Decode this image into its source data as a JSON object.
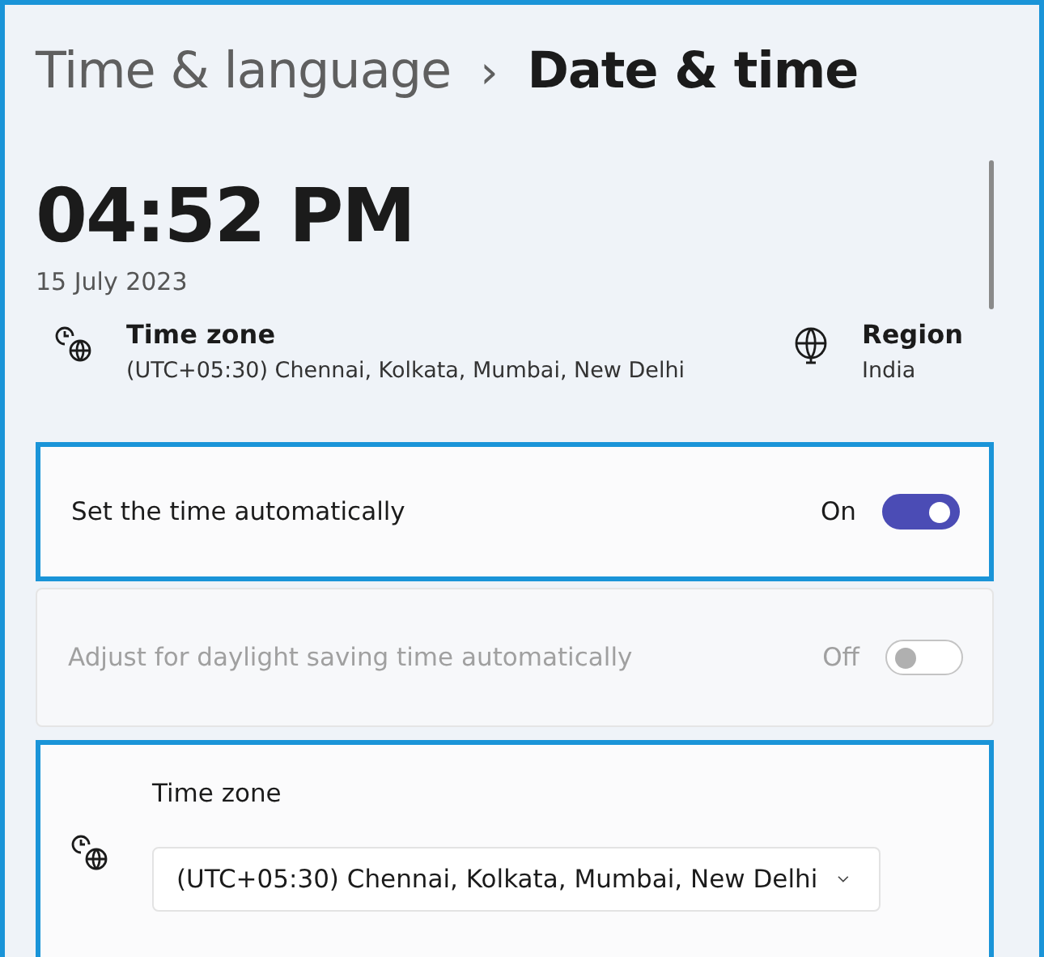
{
  "breadcrumb": {
    "parent": "Time & language",
    "separator": "›",
    "current": "Date & time"
  },
  "clock": {
    "time": "04:52 PM",
    "date": "15 July 2023"
  },
  "info": [
    {
      "kind": "timezone",
      "label": "Time zone",
      "value": "(UTC+05:30) Chennai, Kolkata, Mumbai, New Delhi"
    },
    {
      "kind": "region",
      "label": "Region",
      "value": "India"
    }
  ],
  "settings": [
    {
      "kind": "toggle",
      "label": "Set the time automatically",
      "state_text": "On",
      "on": true,
      "disabled": false,
      "highlighted": true
    },
    {
      "kind": "toggle",
      "label": "Adjust for daylight saving time automatically",
      "state_text": "Off",
      "on": false,
      "disabled": true,
      "highlighted": false
    },
    {
      "kind": "dropdown",
      "label": "Time zone",
      "value": "(UTC+05:30) Chennai, Kolkata, Mumbai, New Delhi",
      "disabled": false,
      "highlighted": true
    }
  ]
}
